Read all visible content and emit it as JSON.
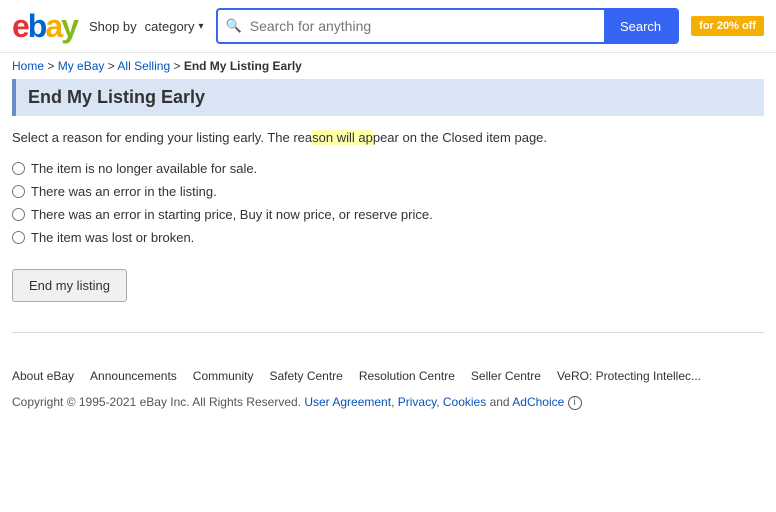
{
  "header": {
    "logo_letters": [
      "e",
      "b",
      "a",
      "y"
    ],
    "shop_by_label": "Shop by",
    "category_label": "category",
    "search_placeholder": "Search for anything",
    "search_btn_label": "Search",
    "promo_label": "for 20% off"
  },
  "breadcrumb": {
    "home": "Home",
    "my_ebay": "My eBay",
    "all_selling": "All Selling",
    "current": "End My Listing Early"
  },
  "page": {
    "title": "End My Listing Early",
    "description_start": "Select a reason for ending your listing early. The rea",
    "description_highlight": "son will ap",
    "description_end": "pear on the Closed item page.",
    "description_full": "Select a reason for ending your listing early. The reason will appear on the Closed item page.",
    "options": [
      {
        "id": "opt1",
        "label": "The item is no longer available for sale."
      },
      {
        "id": "opt2",
        "label": "There was an error in the listing."
      },
      {
        "id": "opt3",
        "label": "There was an error in starting price, Buy it now price, or reserve price."
      },
      {
        "id": "opt4",
        "label": "The item was lost or broken."
      }
    ],
    "end_button_label": "End my listing"
  },
  "footer": {
    "links": [
      "About eBay",
      "Announcements",
      "Community",
      "Safety Centre",
      "Resolution Centre",
      "Seller Centre",
      "VeRO: Protecting Intellec..."
    ],
    "copyright": "Copyright © 1995-2021 eBay Inc. All Rights Reserved.",
    "copyright_links": [
      {
        "label": "User Agreement"
      },
      {
        "label": "Privacy"
      },
      {
        "label": "Cookies"
      }
    ],
    "adchoice": "AdChoice"
  }
}
